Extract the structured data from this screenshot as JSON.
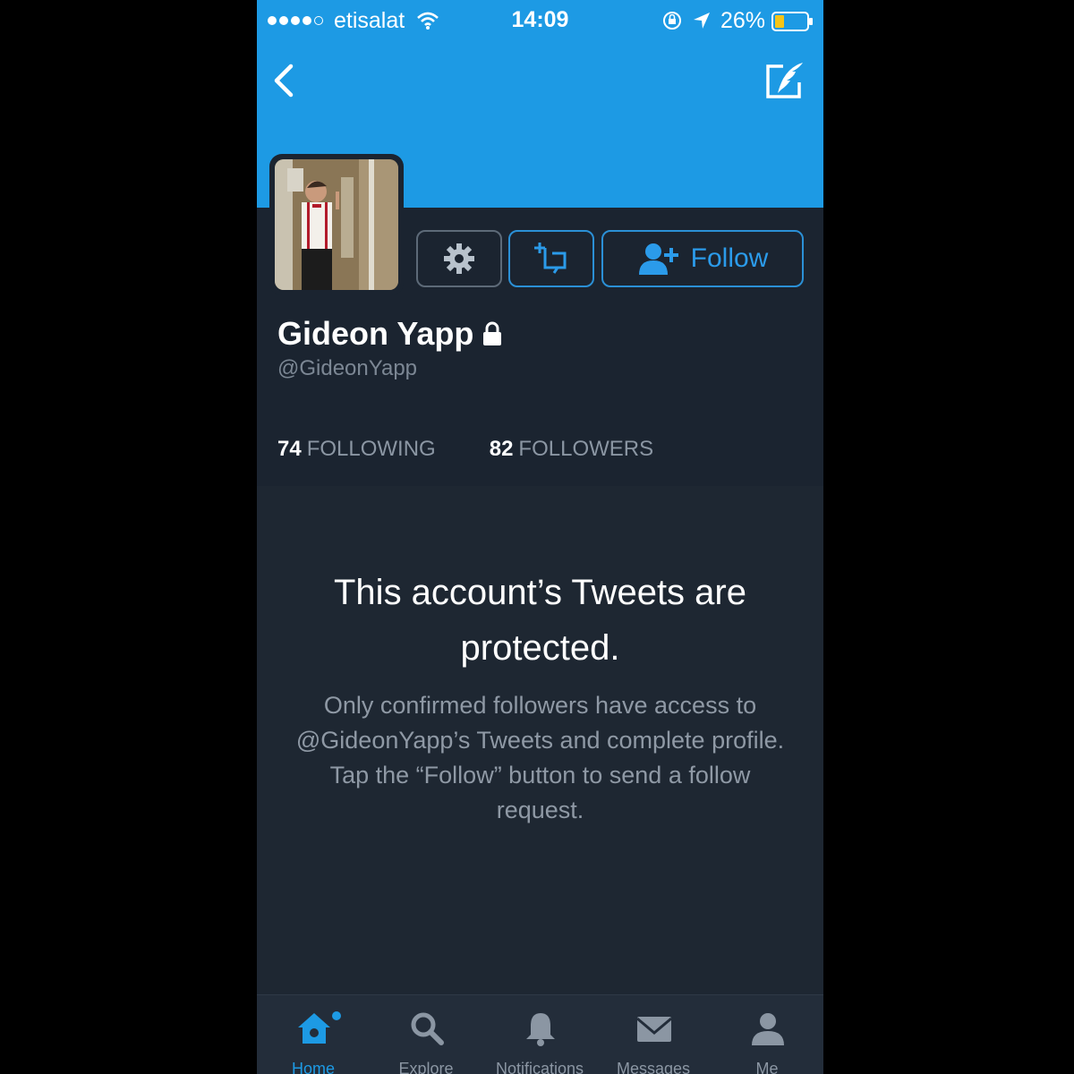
{
  "status_bar": {
    "carrier": "etisalat",
    "time": "14:09",
    "battery": "26%",
    "signal_bars_filled": 4,
    "signal_bars_total": 5
  },
  "profile": {
    "name": "Gideon Yapp",
    "handle": "@GideonYapp",
    "following_count": "74",
    "following_label": "FOLLOWING",
    "followers_count": "82",
    "followers_label": "FOLLOWERS",
    "follow_label": "Follow",
    "is_protected": true
  },
  "protected_notice": {
    "title": "This account’s Tweets are protected.",
    "body": "Only confirmed followers have access to @GideonYapp’s Tweets and complete profile. Tap the “Follow” button to send a follow request."
  },
  "tabbar": {
    "items": [
      {
        "label": "Home",
        "icon": "home-icon",
        "active": true
      },
      {
        "label": "Explore",
        "icon": "search-icon",
        "active": false
      },
      {
        "label": "Notifications",
        "icon": "bell-icon",
        "active": false
      },
      {
        "label": "Messages",
        "icon": "envelope-icon",
        "active": false
      },
      {
        "label": "Me",
        "icon": "person-icon",
        "active": false
      }
    ]
  },
  "colors": {
    "accent": "#1d9ae4",
    "background": "#1b2430",
    "banner": "#1d9ae4"
  }
}
